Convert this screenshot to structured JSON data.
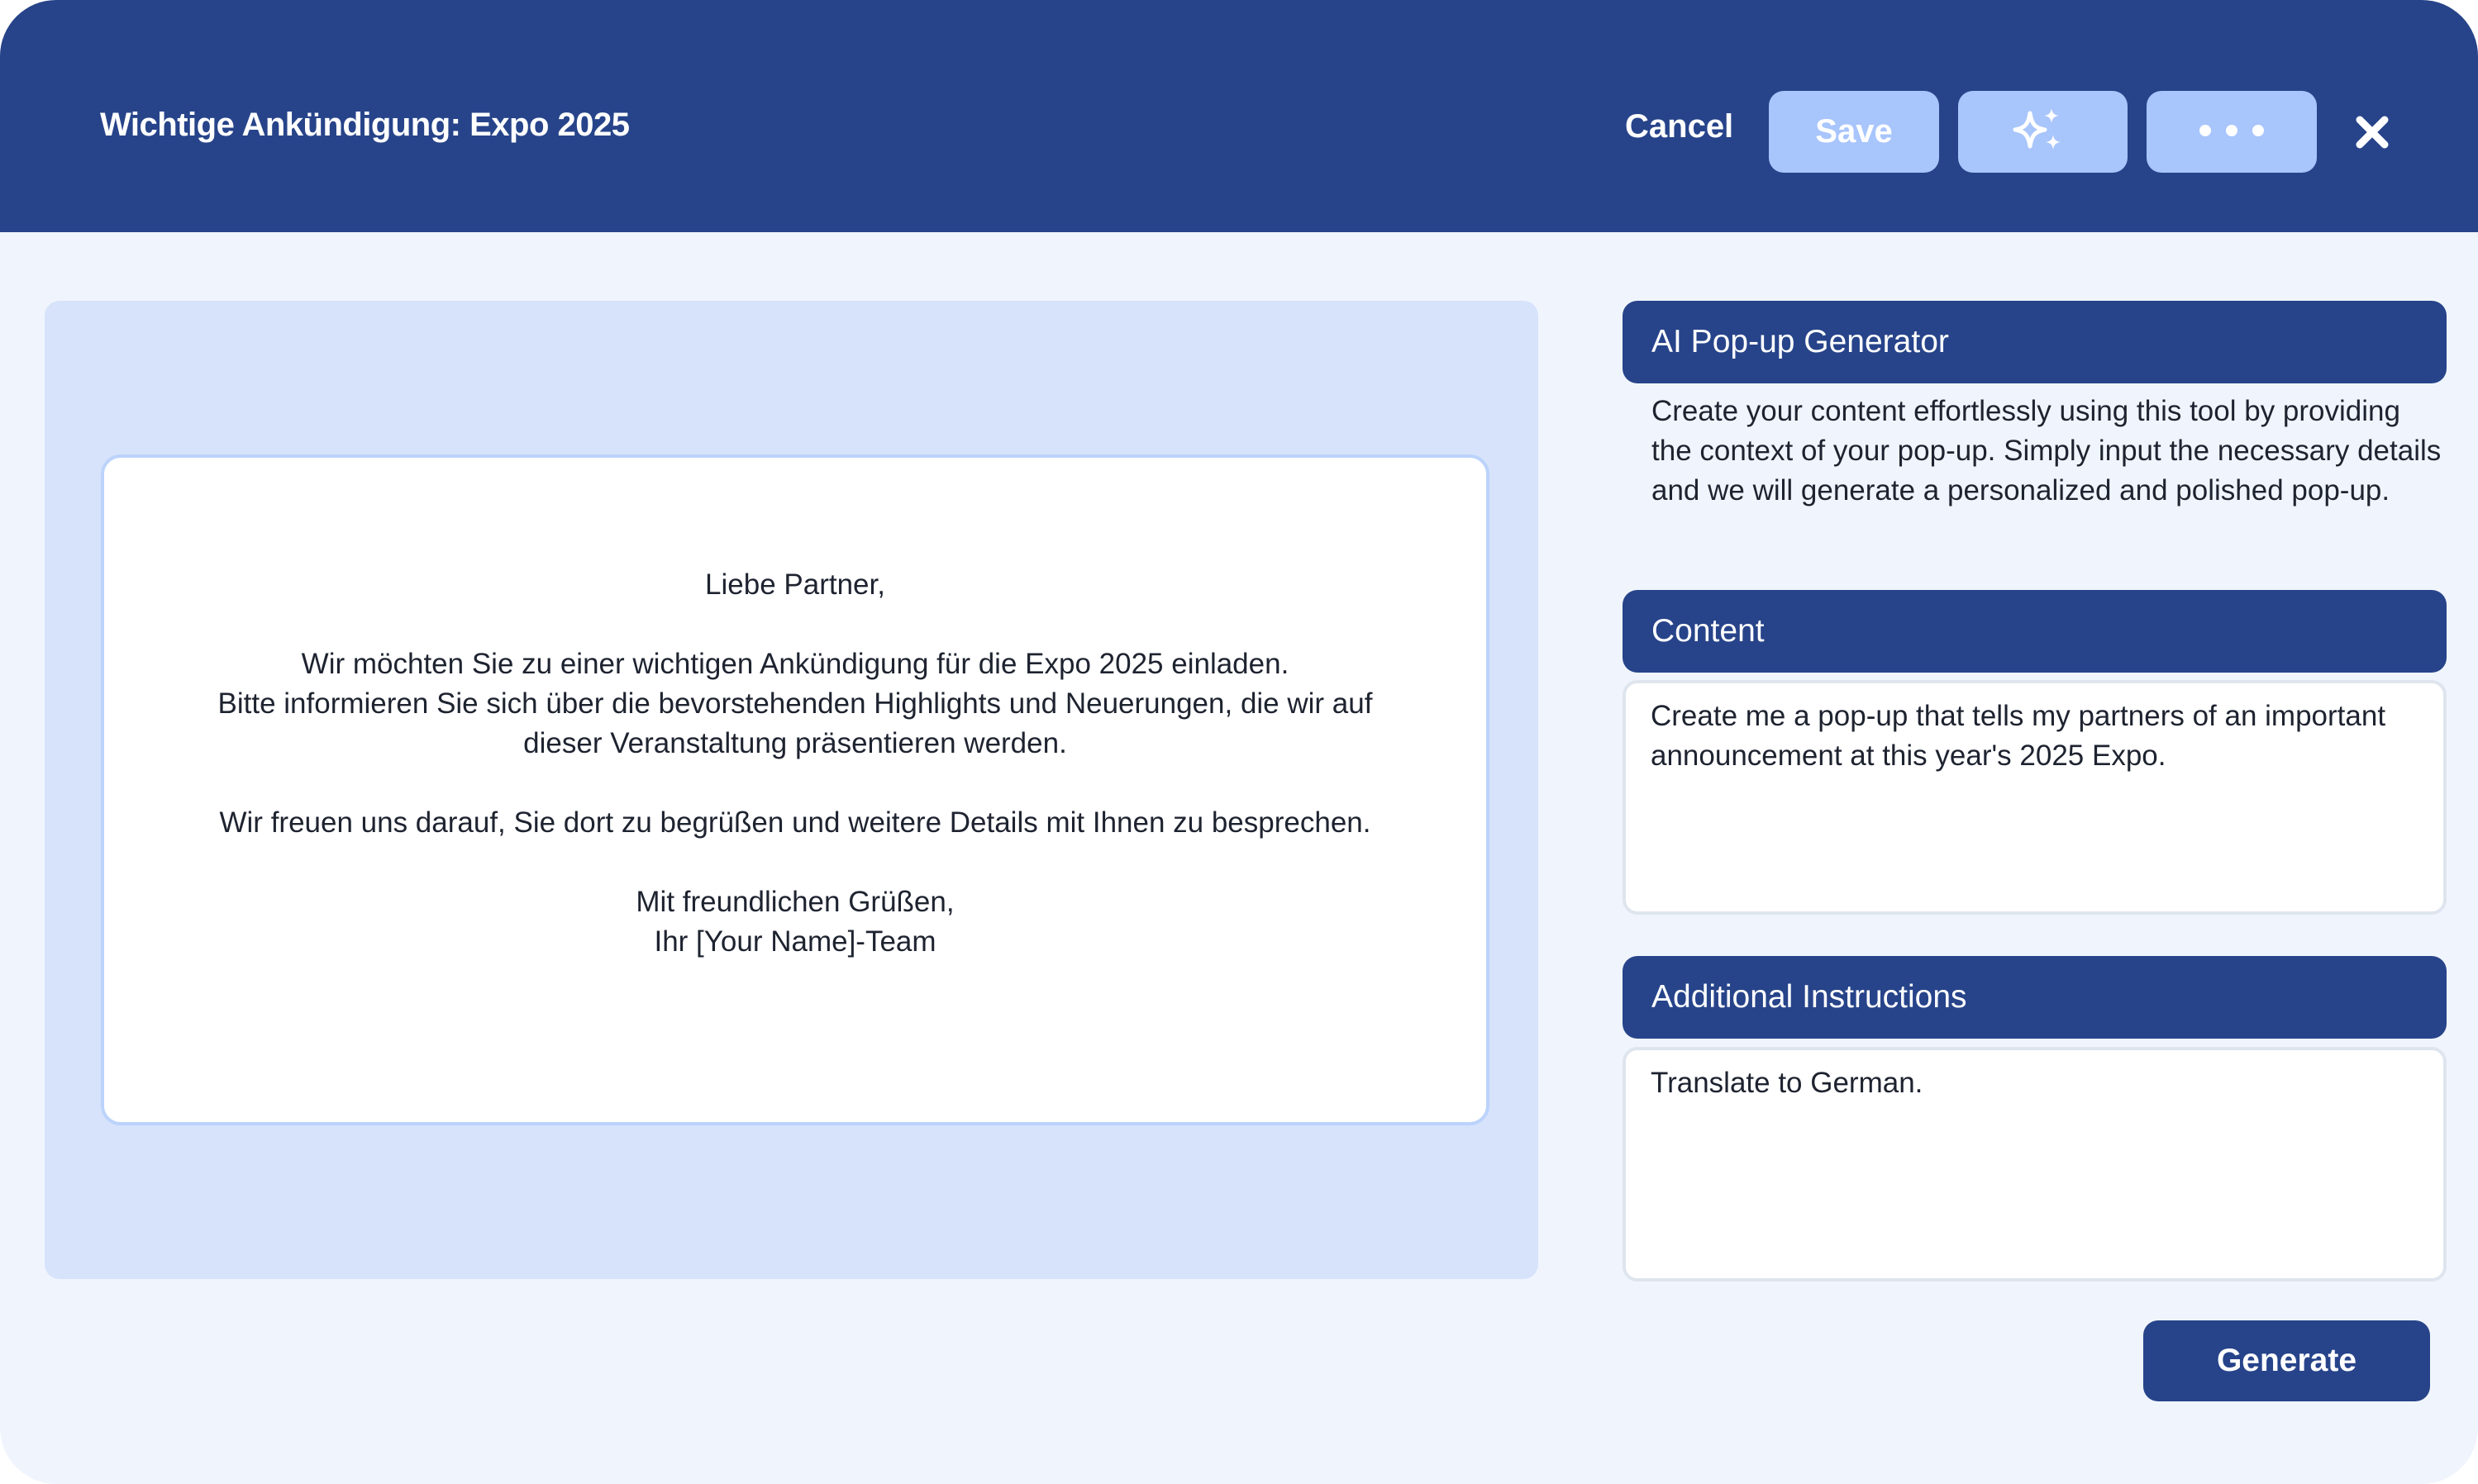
{
  "header": {
    "title": "Wichtige Ankündigung: Expo 2025",
    "cancel_label": "Cancel",
    "save_label": "Save",
    "ai_icon": "sparkles-icon",
    "more_icon": "more-horizontal-icon",
    "close_icon": "close-icon"
  },
  "preview": {
    "greeting": "Liebe Partner,",
    "paragraph1": [
      "Wir möchten Sie zu einer wichtigen Ankündigung für die Expo 2025 einladen.",
      "Bitte informieren Sie sich über die bevorstehenden Highlights und Neuerungen, die wir auf",
      "dieser Veranstaltung präsentieren werden."
    ],
    "paragraph2": "Wir freuen uns darauf, Sie dort zu begrüßen und weitere Details mit Ihnen zu besprechen.",
    "closing": "Mit freundlichen Grüßen,",
    "signature": "Ihr [Your Name]-Team"
  },
  "sidebar": {
    "generator_title": "AI Pop-up Generator",
    "generator_desc": "Create your content effortlessly using this tool by providing the context of your pop-up. Simply input the necessary details and we will generate a personalized and polished pop-up.",
    "content_title": "Content",
    "content_value": "Create me a pop-up that tells my partners of an important announcement at this year's 2025 Expo.",
    "instructions_title": "Additional Instructions",
    "instructions_value": "Translate to German.",
    "generate_label": "Generate"
  },
  "colors": {
    "primary": "#27448a",
    "button_light": "#a8c5fc",
    "preview_bg": "#d6e3fb",
    "page_bg": "#f0f5fd"
  }
}
